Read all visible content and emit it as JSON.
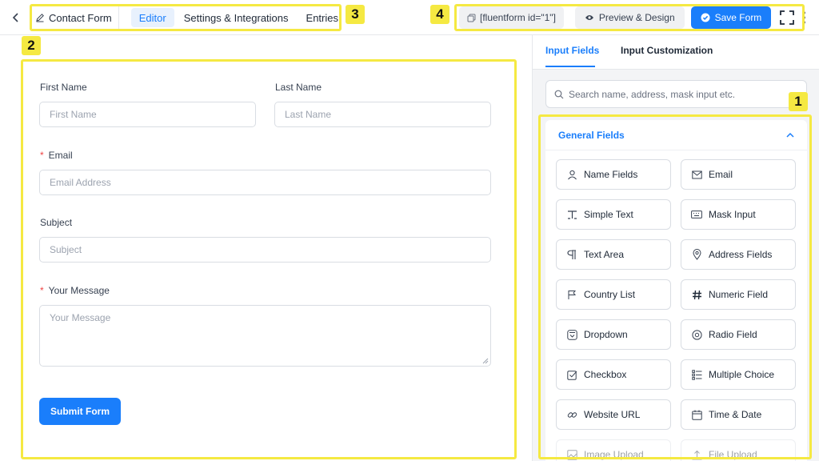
{
  "topbar": {
    "form_title": "Contact Form",
    "tabs": [
      {
        "label": "Editor",
        "active": true
      },
      {
        "label": "Settings & Integrations",
        "active": false
      },
      {
        "label": "Entries",
        "active": false
      }
    ],
    "shortcode": "[fluentform id=\"1\"]",
    "preview_label": "Preview & Design",
    "save_label": "Save Form"
  },
  "annotations": [
    "1",
    "2",
    "3",
    "4"
  ],
  "form": {
    "first_name": {
      "label": "First Name",
      "placeholder": "First Name"
    },
    "last_name": {
      "label": "Last Name",
      "placeholder": "Last Name"
    },
    "email": {
      "label": "Email",
      "placeholder": "Email Address",
      "required": "*"
    },
    "subject": {
      "label": "Subject",
      "placeholder": "Subject"
    },
    "message": {
      "label": "Your Message",
      "placeholder": "Your Message",
      "required": "*"
    },
    "submit_label": "Submit Form"
  },
  "sidebar": {
    "tabs": [
      {
        "label": "Input Fields",
        "active": true
      },
      {
        "label": "Input Customization",
        "active": false
      }
    ],
    "search_placeholder": "Search name, address, mask input etc.",
    "group_title": "General Fields",
    "fields": [
      {
        "label": "Name Fields",
        "icon": "user-icon"
      },
      {
        "label": "Email",
        "icon": "envelope-icon"
      },
      {
        "label": "Simple Text",
        "icon": "text-cursor-icon"
      },
      {
        "label": "Mask Input",
        "icon": "keyboard-icon"
      },
      {
        "label": "Text Area",
        "icon": "paragraph-icon"
      },
      {
        "label": "Address Fields",
        "icon": "map-pin-icon"
      },
      {
        "label": "Country List",
        "icon": "flag-icon"
      },
      {
        "label": "Numeric Field",
        "icon": "hash-icon"
      },
      {
        "label": "Dropdown",
        "icon": "dropdown-icon"
      },
      {
        "label": "Radio Field",
        "icon": "radio-icon"
      },
      {
        "label": "Checkbox",
        "icon": "checkbox-icon"
      },
      {
        "label": "Multiple Choice",
        "icon": "list-icon"
      },
      {
        "label": "Website URL",
        "icon": "link-icon"
      },
      {
        "label": "Time & Date",
        "icon": "calendar-icon"
      },
      {
        "label": "Image Upload",
        "icon": "image-icon"
      },
      {
        "label": "File Upload",
        "icon": "upload-icon"
      }
    ]
  },
  "colors": {
    "accent": "#1a7efb",
    "highlight": "#f5e942",
    "required": "#ef4444"
  }
}
